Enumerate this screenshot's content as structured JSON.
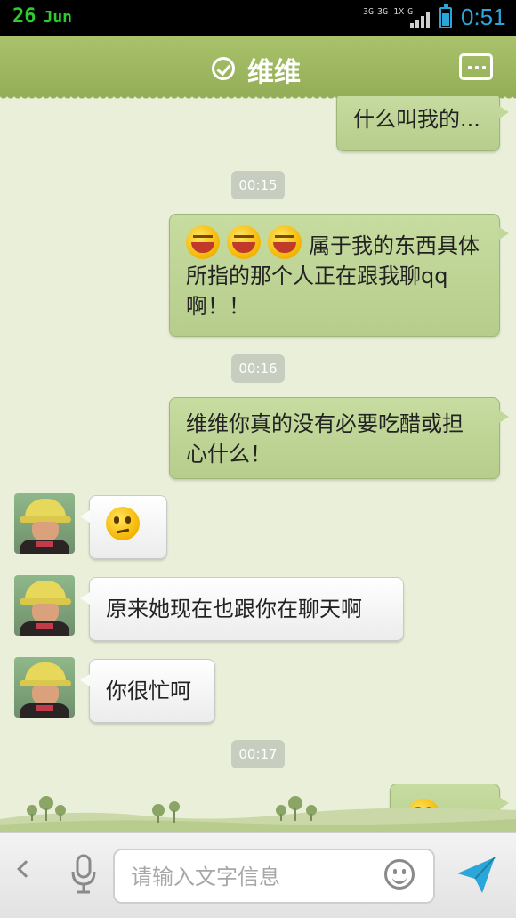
{
  "status_bar": {
    "day": "26",
    "month": "Jun",
    "network_a": "3G",
    "network_b": "3G 1X",
    "network_c": "G",
    "time": "0:51"
  },
  "header": {
    "title": "维维",
    "verified_icon": "check-circle-icon",
    "menu_icon": "more-icon"
  },
  "messages": [
    {
      "side": "right",
      "text": "什么叫我的..."
    },
    {
      "type": "timestamp",
      "text": "00:15"
    },
    {
      "side": "right",
      "emoji": [
        "laugh",
        "laugh",
        "laugh"
      ],
      "text": "属于我的东西具体所指的那个人正在跟我聊qq啊！！"
    },
    {
      "type": "timestamp",
      "text": "00:16"
    },
    {
      "side": "right",
      "text": "维维你真的没有必要吃醋或担心什么！"
    },
    {
      "side": "left",
      "emoji": [
        "think"
      ],
      "text": ""
    },
    {
      "side": "left",
      "text": "原来她现在也跟你在聊天啊"
    },
    {
      "side": "left",
      "text": "你很忙呵"
    },
    {
      "type": "timestamp",
      "text": "00:17"
    },
    {
      "side": "right",
      "emoji": [
        "dizzy",
        "dizzy"
      ],
      "text": ""
    }
  ],
  "input_bar": {
    "placeholder": "请输入文字信息",
    "value": ""
  },
  "colors": {
    "header": "#9db55e",
    "bubble_right": "#bfd596",
    "accent_blue": "#2aa6d8"
  }
}
